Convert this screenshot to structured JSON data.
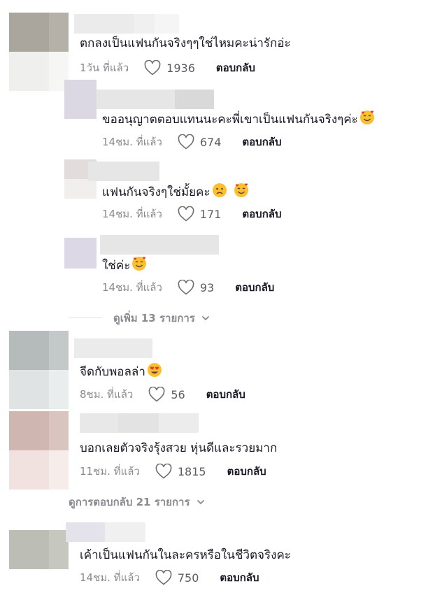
{
  "comments": [
    {
      "text": "ตกลงเป็นแฟนกันจริงๆๆใช่ไหมคะน่ารักอ่ะ",
      "time": "1วัน ที่แล้ว",
      "likes": "1936",
      "reply": "ตอบกลับ",
      "emoji": ""
    },
    {
      "text": "ขออนุญาตตอบแทนนะคะพี่เขาเป็นแฟนกันจริงๆค่ะ",
      "time": "14ชม. ที่แล้ว",
      "likes": "674",
      "reply": "ตอบกลับ",
      "emoji": "smiling-hearts"
    },
    {
      "text": "แฟนกันจริงๆใช่มั้ยคะ",
      "time": "14ชม. ที่แล้ว",
      "likes": "171",
      "reply": "ตอบกลับ",
      "emoji": "frowning+smiling-hearts"
    },
    {
      "text": "ใช่ค่ะ",
      "time": "14ชม. ที่แล้ว",
      "likes": "93",
      "reply": "ตอบกลับ",
      "emoji": "smiling-hearts"
    },
    {
      "text": "จีดกับพอลล่า",
      "time": "8ชม. ที่แล้ว",
      "likes": "56",
      "reply": "ตอบกลับ",
      "emoji": "heart-eyes"
    },
    {
      "text": "บอกเลยตัวจริงรุ้งสวย หุ่นดีและรวยมาก",
      "time": "11ชม. ที่แล้ว",
      "likes": "1815",
      "reply": "ตอบกลับ",
      "emoji": ""
    },
    {
      "text": "เค้าเป็นแฟนกันในละครหรือในชีวิตจริงคะ",
      "time": "14ชม. ที่แล้ว",
      "likes": "750",
      "reply": "ตอบกลับ",
      "emoji": ""
    }
  ],
  "view_more_replies": "ดูเพิ่ม 13 รายการ",
  "view_replies": "ดูการตอบกลับ 21 รายการ",
  "icons": {
    "like": "heart-outline-icon",
    "expand": "chevron-down-icon"
  },
  "colors": {
    "text": "#161823",
    "muted": "#8a8b91",
    "background": "#ffffff"
  }
}
